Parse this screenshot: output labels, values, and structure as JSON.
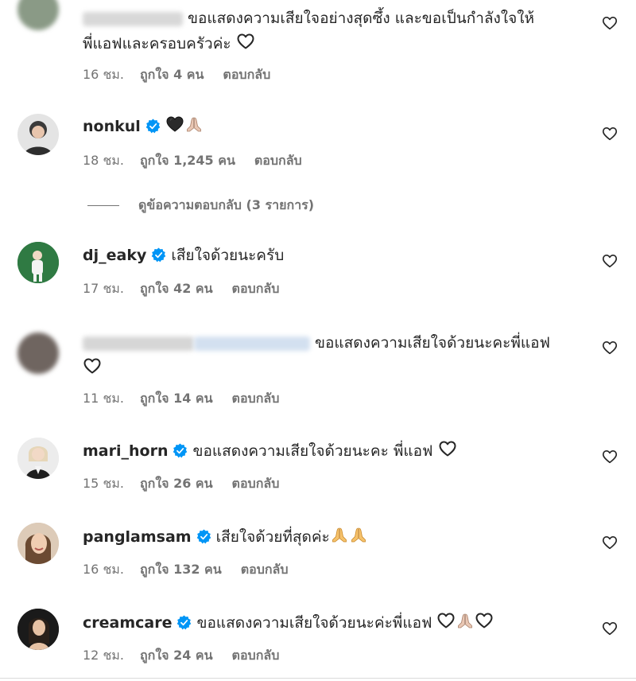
{
  "comments": [
    {
      "username": "",
      "text": "ขอแสดงความเสียใจอย่างสุดซึ้ง และขอเป็นกำลังใจให้",
      "text2": "พี่แอฟและครอบครัวค่ะ",
      "time": "16 ชม.",
      "likes": "ถูกใจ 4 คน",
      "reply": "ตอบกลับ",
      "emoji": "white-heart"
    },
    {
      "username": "nonkul",
      "text": "",
      "time": "18 ชม.",
      "likes": "ถูกใจ 1,245 คน",
      "reply": "ตอบกลับ",
      "emoji": "black-heart praying-hands"
    },
    {
      "username": "dj_eaky",
      "text": "เสียใจด้วยนะครับ",
      "time": "17 ชม.",
      "likes": "ถูกใจ 42 คน",
      "reply": "ตอบกลับ"
    },
    {
      "username": "",
      "text": "ขอแสดงความเสียใจด้วยนะคะพี่แอฟ",
      "time": "11 ชม.",
      "likes": "ถูกใจ 14 คน",
      "reply": "ตอบกลับ",
      "emoji": "white-heart"
    },
    {
      "username": "mari_horn",
      "text": "ขอแสดงความเสียใจด้วยนะคะ พี่แอฟ",
      "time": "15 ชม.",
      "likes": "ถูกใจ 26 คน",
      "reply": "ตอบกลับ",
      "emoji": "white-heart"
    },
    {
      "username": "panglamsam",
      "text": "เสียใจด้วยที่สุดค่ะ",
      "time": "16 ชม.",
      "likes": "ถูกใจ 132 คน",
      "reply": "ตอบกลับ",
      "emoji": "praying-hands praying-hands"
    },
    {
      "username": "creamcare",
      "text": "ขอแสดงความเสียใจด้วยนะค่ะพี่แอฟ",
      "time": "12 ชม.",
      "likes": "ถูกใจ 24 คน",
      "reply": "ตอบกลับ",
      "emoji": "white-heart praying-hands white-heart"
    }
  ],
  "view_replies": "ดูข้อความตอบกลับ (3 รายการ)",
  "colors": {
    "verified": "#0095f6",
    "meta": "#737373",
    "text": "#262626"
  }
}
